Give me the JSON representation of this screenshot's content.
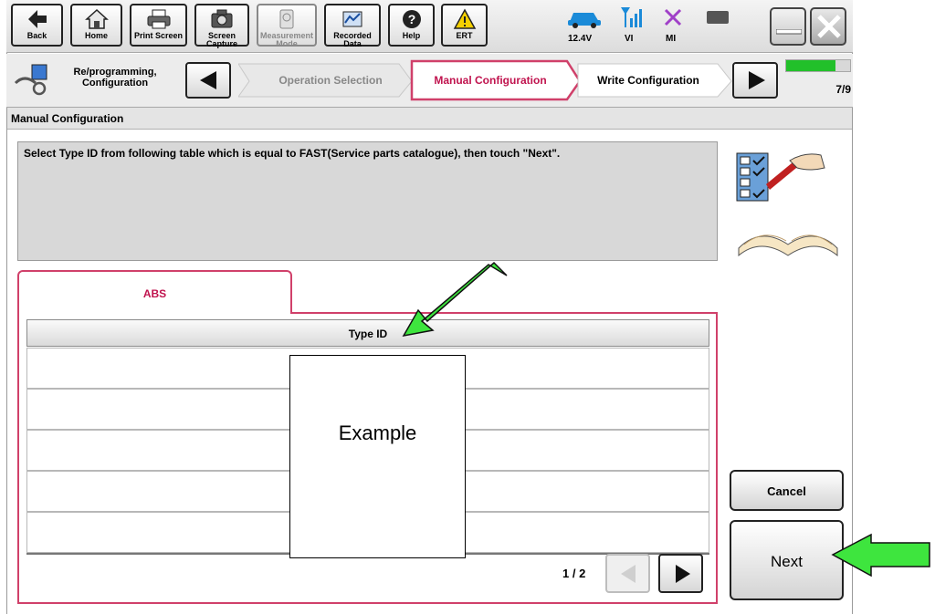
{
  "toolbar": {
    "back": "Back",
    "home": "Home",
    "print_screen": "Print Screen",
    "screen_capture": "Screen Capture",
    "measurement_mode": "Measurement Mode",
    "recorded_data": "Recorded Data",
    "help": "Help",
    "ert": "ERT"
  },
  "status": {
    "voltage": "12.4V",
    "vi": "VI",
    "mi": "MI"
  },
  "nav": {
    "current_mode": "Re/programming, Configuration",
    "step_prev": "Operation Selection",
    "step_current": "Manual Configuration",
    "step_next": "Write Configuration",
    "progress_label": "7/9",
    "progress_fraction": 0.778
  },
  "page": {
    "title": "Manual Configuration",
    "instruction": "Select Type ID from following table which is equal to FAST(Service parts catalogue), then touch \"Next\"."
  },
  "tabs": [
    {
      "label": "ABS"
    }
  ],
  "table": {
    "header": "Type ID",
    "rows": [
      "",
      "",
      "",
      "",
      ""
    ]
  },
  "pager": {
    "label": "1 / 2"
  },
  "overlay": {
    "example_label": "Example"
  },
  "buttons": {
    "cancel": "Cancel",
    "next": "Next"
  },
  "colors": {
    "accent": "#c0134e",
    "progress": "#22c02a",
    "annotation_arrow": "#3ee53e"
  }
}
